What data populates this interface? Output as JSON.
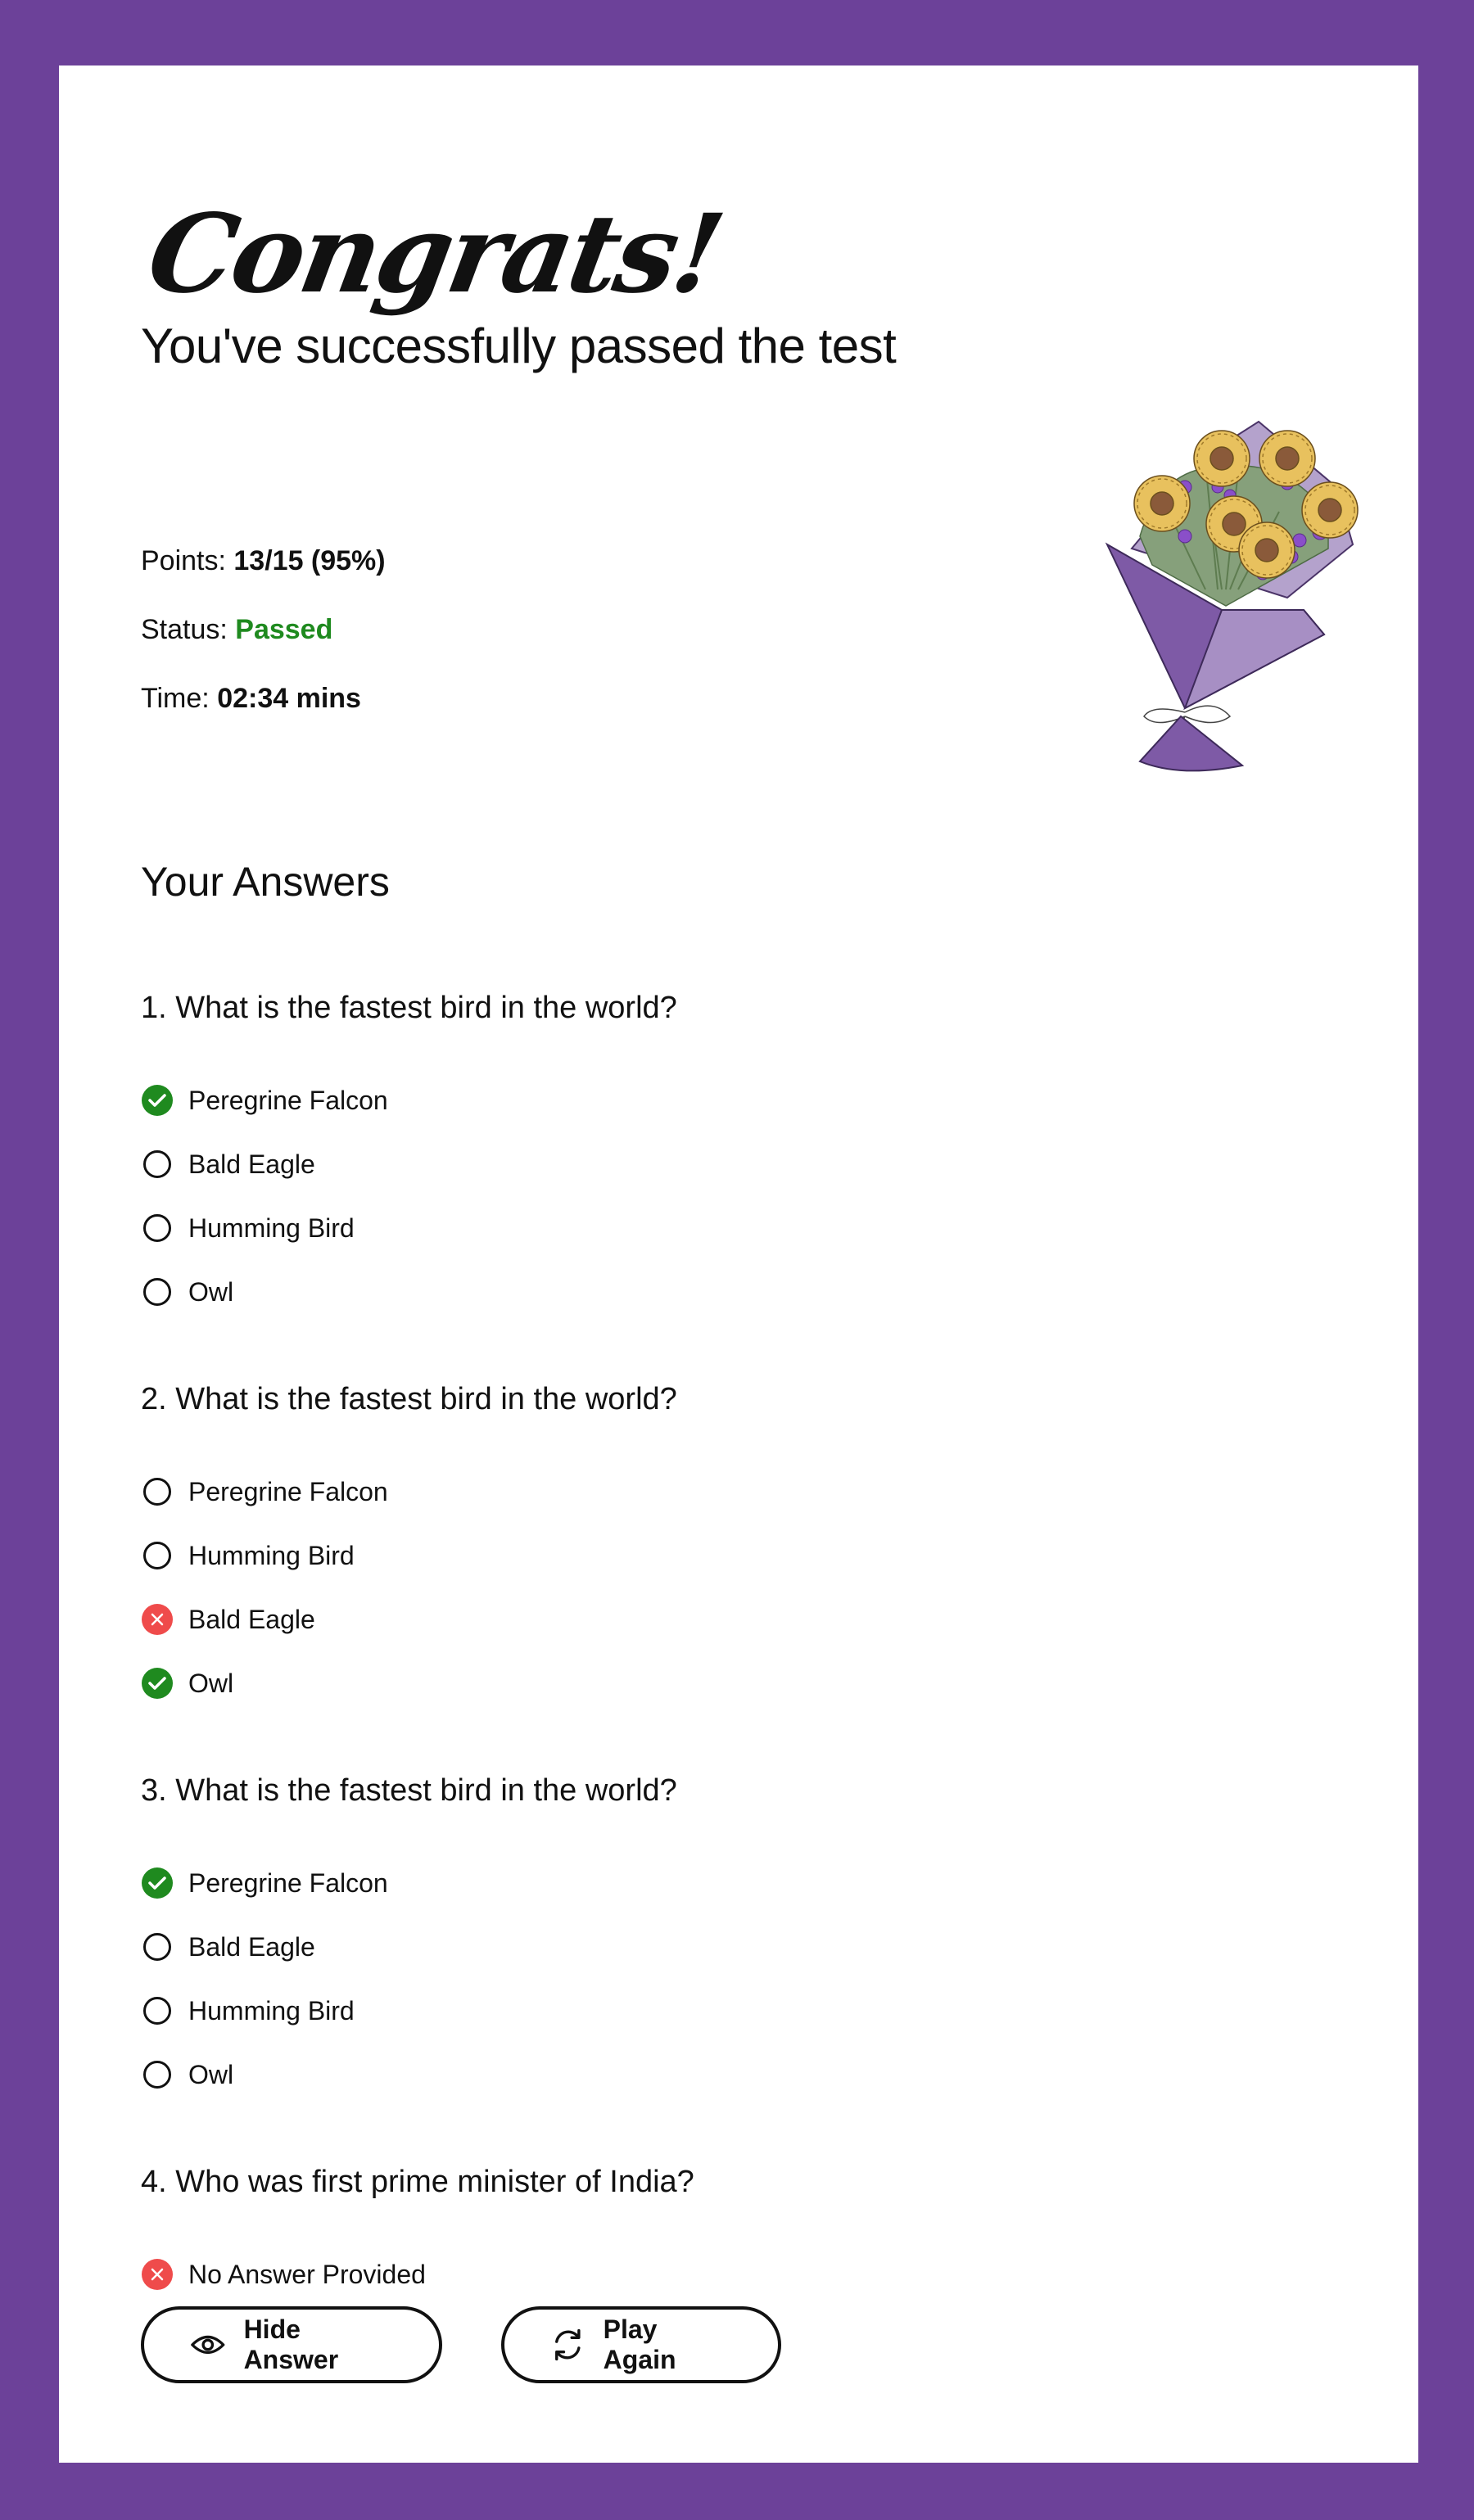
{
  "header": {
    "congrats": "Congrats!",
    "subtitle": "You've successfully passed the test"
  },
  "stats": {
    "points_label": "Points: ",
    "points_value": "13/15 (95%)",
    "status_label": "Status: ",
    "status_value": "Passed",
    "time_label": "Time: ",
    "time_value": "02:34 mins"
  },
  "answers": {
    "title": "Your Answers",
    "questions": [
      {
        "number": "1.",
        "text": "What is the fastest bird in the world?",
        "options": [
          {
            "label": "Peregrine Falcon",
            "state": "correct"
          },
          {
            "label": "Bald Eagle",
            "state": "none"
          },
          {
            "label": "Humming Bird",
            "state": "none"
          },
          {
            "label": "Owl",
            "state": "none"
          }
        ]
      },
      {
        "number": "2.",
        "text": "What is the fastest bird in the world?",
        "options": [
          {
            "label": "Peregrine Falcon",
            "state": "none"
          },
          {
            "label": "Humming Bird",
            "state": "none"
          },
          {
            "label": "Bald Eagle",
            "state": "wrong"
          },
          {
            "label": "Owl",
            "state": "correct"
          }
        ]
      },
      {
        "number": "3.",
        "text": "What is the fastest bird in the world?",
        "options": [
          {
            "label": "Peregrine Falcon",
            "state": "correct"
          },
          {
            "label": "Bald Eagle",
            "state": "none"
          },
          {
            "label": "Humming Bird",
            "state": "none"
          },
          {
            "label": "Owl",
            "state": "none"
          }
        ]
      },
      {
        "number": "4.",
        "text": "Who was first prime minister of India?",
        "options": [
          {
            "label": "No Answer Provided",
            "state": "wrong"
          }
        ]
      }
    ]
  },
  "buttons": {
    "hide_answer": "Hide Answer",
    "play_again": "Play Again"
  },
  "colors": {
    "background": "#6c4199",
    "correct": "#1f8a1f",
    "wrong": "#ef4b4b",
    "passed": "#1f8a1f"
  },
  "icons": {
    "correct": "check-circle-icon",
    "wrong": "x-circle-icon",
    "unselected": "radio-empty-icon",
    "hide": "eye-icon",
    "replay": "refresh-icon",
    "illustration": "flower-bouquet"
  }
}
